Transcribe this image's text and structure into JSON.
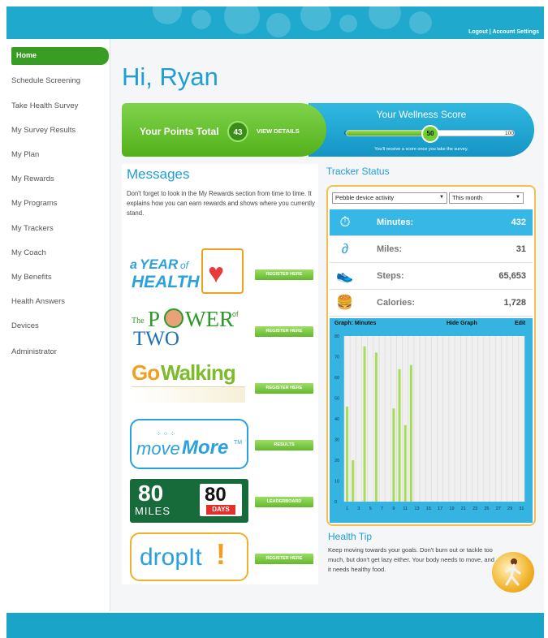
{
  "header": {
    "logout": "Logout",
    "separator": "|",
    "account_settings": "Account Settings"
  },
  "sidebar": {
    "home": "Home",
    "items": [
      "Schedule Screening",
      "Take Health Survey",
      "My Survey Results",
      "My Plan",
      "My Rewards",
      "My Programs",
      "My Trackers",
      "My Coach",
      "My Benefits",
      "Health Answers",
      "Devices",
      "Administrator"
    ]
  },
  "greeting": "Hi, Ryan",
  "points": {
    "label": "Your Points Total",
    "value": "43",
    "details": "VIEW DETAILS"
  },
  "wellness": {
    "title": "Your Wellness Score",
    "min": "0",
    "score": "50",
    "max": "100",
    "score_fraction": 0.5,
    "note": "You'll receive a score once you take the survey."
  },
  "messages": {
    "title": "Messages",
    "text": "Don't forget to look in the My Rewards section from time to time. It explains how you can earn rewards and shows where you currently stand."
  },
  "programs": [
    {
      "logo_text": "a YEAR of HEALTH",
      "button": "REGISTER HERE"
    },
    {
      "logo_text": "The POWER of TWO",
      "button": "REGISTER HERE"
    },
    {
      "logo_text": "Go Walking",
      "button": "REGISTER HERE"
    },
    {
      "logo_text": "moveMore",
      "button": "RESULTS"
    },
    {
      "logo_text": "80 MILES 80 DAYS",
      "button": "LEADERBOARD"
    },
    {
      "logo_text": "dropIt!",
      "button": "REGISTER HERE"
    }
  ],
  "tracker": {
    "title": "Tracker Status",
    "device_select": "Pebble device activity",
    "period_select": "This month",
    "metrics": [
      {
        "name": "Minutes:",
        "value": "432",
        "icon": "stopwatch-icon",
        "active": true
      },
      {
        "name": "Miles:",
        "value": "31",
        "icon": "route-icon",
        "active": false
      },
      {
        "name": "Steps:",
        "value": "65,653",
        "icon": "shoe-icon",
        "active": false
      },
      {
        "name": "Calories:",
        "value": "1,728",
        "icon": "food-icon",
        "active": false
      }
    ],
    "graph_label": "Graph: Minutes",
    "hide_graph": "Hide Graph",
    "edit": "Edit"
  },
  "chart_data": {
    "type": "bar",
    "ylim": [
      0,
      80
    ],
    "yticks": [
      0,
      10,
      20,
      30,
      40,
      50,
      60,
      70,
      80
    ],
    "xticks": [
      "1",
      "3",
      "5",
      "7",
      "9",
      "11",
      "13",
      "15",
      "17",
      "19",
      "21",
      "23",
      "25",
      "27",
      "29",
      "31"
    ],
    "days": [
      1,
      2,
      3,
      4,
      5,
      6,
      7,
      8,
      9,
      10,
      11,
      12,
      13,
      14,
      15,
      16,
      17,
      18,
      19,
      20,
      21,
      22,
      23,
      24,
      25,
      26,
      27,
      28,
      29,
      30,
      31
    ],
    "values": [
      46,
      20,
      0,
      75,
      0,
      72,
      0,
      0,
      45,
      64,
      37,
      66,
      0,
      0,
      0,
      0,
      0,
      0,
      0,
      0,
      0,
      0,
      0,
      0,
      0,
      0,
      0,
      0,
      0,
      0,
      0
    ],
    "bar_color": "#a8dc5a"
  },
  "health_tip": {
    "title": "Health Tip",
    "text": "Keep moving towards your goals. Don't burn out or tackle too much, but don't get lazy either. Your body needs to move, and it needs healthy food."
  },
  "colors": {
    "brand_blue": "#1fa9cc",
    "accent_green": "#3a9d23",
    "link_blue": "#1f9ed6"
  }
}
